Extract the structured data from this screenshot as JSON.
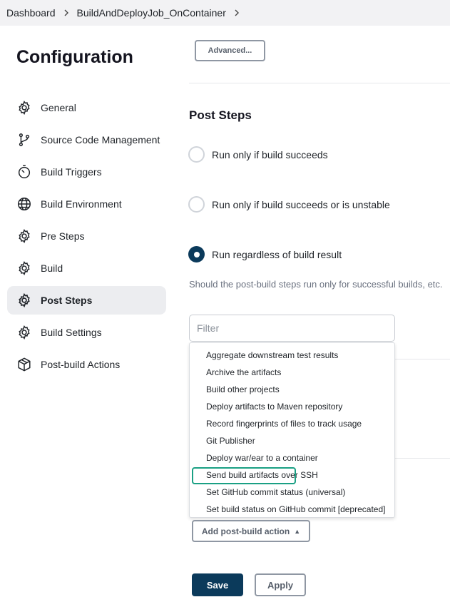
{
  "breadcrumb": {
    "items": [
      "Dashboard",
      "BuildAndDeployJob_OnContainer"
    ]
  },
  "page_title": "Configuration",
  "sidebar": {
    "items": [
      {
        "label": "General",
        "icon": "gear-icon"
      },
      {
        "label": "Source Code Management",
        "icon": "branch-icon"
      },
      {
        "label": "Build Triggers",
        "icon": "timer-icon"
      },
      {
        "label": "Build Environment",
        "icon": "globe-icon"
      },
      {
        "label": "Pre Steps",
        "icon": "gear-icon"
      },
      {
        "label": "Build",
        "icon": "gear-icon"
      },
      {
        "label": "Post Steps",
        "icon": "gear-icon",
        "active": true
      },
      {
        "label": "Build Settings",
        "icon": "gear-icon"
      },
      {
        "label": "Post-build Actions",
        "icon": "package-icon"
      }
    ]
  },
  "main": {
    "advanced_label": "Advanced...",
    "post_steps": {
      "title": "Post Steps",
      "options": [
        {
          "label": "Run only if build succeeds",
          "checked": false
        },
        {
          "label": "Run only if build succeeds or is unstable",
          "checked": false
        },
        {
          "label": "Run regardless of build result",
          "checked": true
        }
      ],
      "help": "Should the post-build steps run only for successful builds, etc."
    },
    "filter": {
      "placeholder": "Filter",
      "value": ""
    },
    "dropdown_items": [
      "Aggregate downstream test results",
      "Archive the artifacts",
      "Build other projects",
      "Deploy artifacts to Maven repository",
      "Record fingerprints of files to track usage",
      "Git Publisher",
      "Deploy war/ear to a container",
      "Send build artifacts over SSH",
      "Set GitHub commit status (universal)",
      "Set build status on GitHub commit [deprecated]"
    ],
    "highlighted_item": "Send build artifacts over SSH",
    "add_post_build_label": "Add post-build action",
    "save_label": "Save",
    "apply_label": "Apply"
  },
  "colors": {
    "accent": "#0b3a5b",
    "highlight": "#1aa084",
    "breadcrumb_bg": "#f2f2f4",
    "active_sidebar_bg": "#ecedf0"
  }
}
